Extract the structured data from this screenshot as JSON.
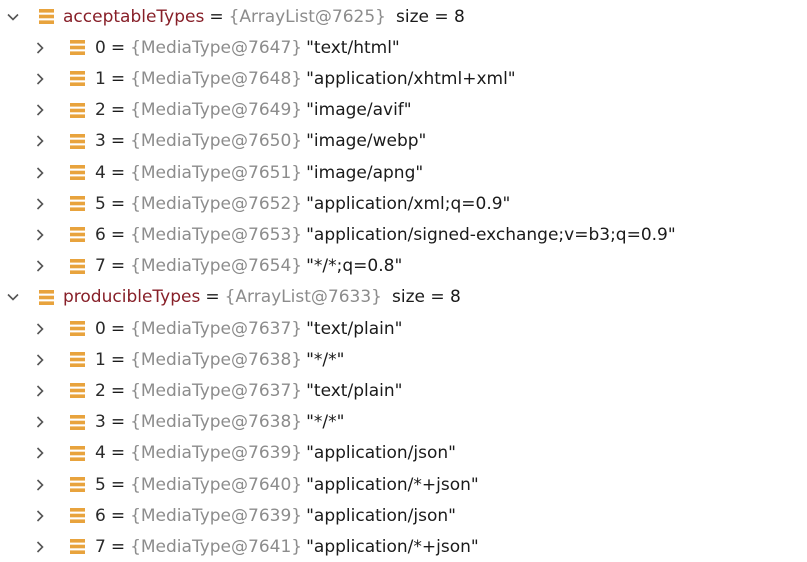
{
  "groups": [
    {
      "name": "acceptableTypes",
      "ref": "{ArrayList@7625}",
      "size_text": "size = 8",
      "items": [
        {
          "index": "0",
          "ref": "{MediaType@7647}",
          "value": "\"text/html\""
        },
        {
          "index": "1",
          "ref": "{MediaType@7648}",
          "value": "\"application/xhtml+xml\""
        },
        {
          "index": "2",
          "ref": "{MediaType@7649}",
          "value": "\"image/avif\""
        },
        {
          "index": "3",
          "ref": "{MediaType@7650}",
          "value": "\"image/webp\""
        },
        {
          "index": "4",
          "ref": "{MediaType@7651}",
          "value": "\"image/apng\""
        },
        {
          "index": "5",
          "ref": "{MediaType@7652}",
          "value": "\"application/xml;q=0.9\""
        },
        {
          "index": "6",
          "ref": "{MediaType@7653}",
          "value": "\"application/signed-exchange;v=b3;q=0.9\""
        },
        {
          "index": "7",
          "ref": "{MediaType@7654}",
          "value": "\"*/*;q=0.8\""
        }
      ]
    },
    {
      "name": "producibleTypes",
      "ref": "{ArrayList@7633}",
      "size_text": "size = 8",
      "items": [
        {
          "index": "0",
          "ref": "{MediaType@7637}",
          "value": "\"text/plain\""
        },
        {
          "index": "1",
          "ref": "{MediaType@7638}",
          "value": "\"*/*\""
        },
        {
          "index": "2",
          "ref": "{MediaType@7637}",
          "value": "\"text/plain\""
        },
        {
          "index": "3",
          "ref": "{MediaType@7638}",
          "value": "\"*/*\""
        },
        {
          "index": "4",
          "ref": "{MediaType@7639}",
          "value": "\"application/json\""
        },
        {
          "index": "5",
          "ref": "{MediaType@7640}",
          "value": "\"application/*+json\""
        },
        {
          "index": "6",
          "ref": "{MediaType@7639}",
          "value": "\"application/json\""
        },
        {
          "index": "7",
          "ref": "{MediaType@7641}",
          "value": "\"application/*+json\""
        }
      ]
    }
  ],
  "eq_sign": "=",
  "icons": {
    "expanded": "chevron-down-icon",
    "collapsed": "chevron-right-icon",
    "field": "field-icon",
    "field_color": "#e8a33d"
  }
}
